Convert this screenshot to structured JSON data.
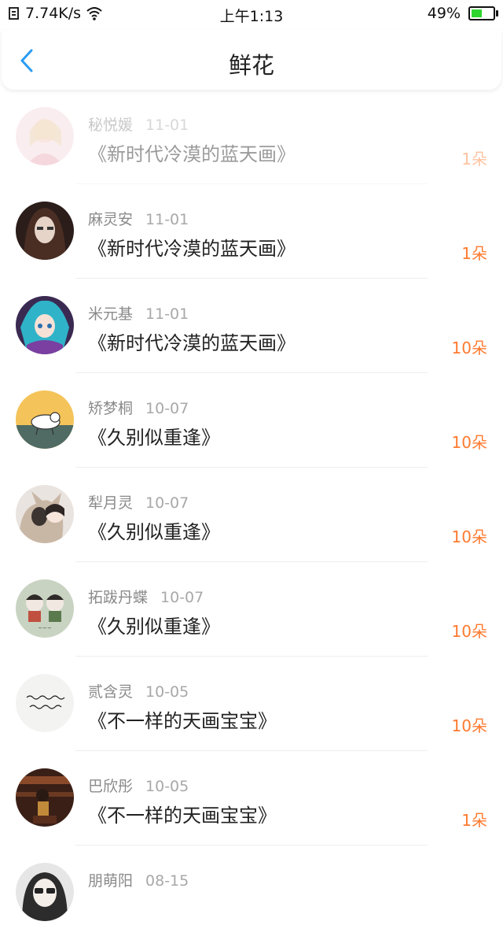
{
  "status_bar": {
    "network_speed": "7.74K/s",
    "time": "上午1:13",
    "battery": "49%",
    "battery_level": 0.49
  },
  "header": {
    "title": "鲜花",
    "back_icon": "chevron-left-icon"
  },
  "accent_color": "#ff7a2f",
  "items": [
    {
      "name": "秘悦媛",
      "date": "11-01",
      "title": "《新时代冷漠的蓝天画》",
      "count": "1朵"
    },
    {
      "name": "麻灵安",
      "date": "11-01",
      "title": "《新时代冷漠的蓝天画》",
      "count": "1朵"
    },
    {
      "name": "米元基",
      "date": "11-01",
      "title": "《新时代冷漠的蓝天画》",
      "count": "10朵"
    },
    {
      "name": "矫梦桐",
      "date": "10-07",
      "title": "《久别似重逢》",
      "count": "10朵"
    },
    {
      "name": "犁月灵",
      "date": "10-07",
      "title": "《久别似重逢》",
      "count": "10朵"
    },
    {
      "name": "拓跋丹蝶",
      "date": "10-07",
      "title": "《久别似重逢》",
      "count": "10朵"
    },
    {
      "name": "贰含灵",
      "date": "10-05",
      "title": "《不一样的天画宝宝》",
      "count": "10朵"
    },
    {
      "name": "巴欣彤",
      "date": "10-05",
      "title": "《不一样的天画宝宝》",
      "count": "1朵"
    },
    {
      "name": "朋萌阳",
      "date": "08-15",
      "title": "",
      "count": ""
    }
  ]
}
